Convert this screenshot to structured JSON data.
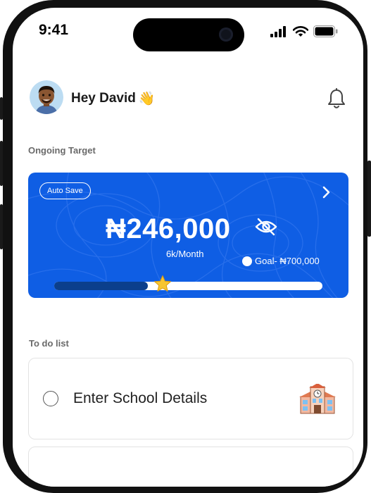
{
  "status_bar": {
    "time": "9:41"
  },
  "header": {
    "greeting": "Hey David",
    "wave_emoji": "👋"
  },
  "ongoing": {
    "section_title": "Ongoing Target",
    "badge": "Auto Save",
    "amount": "₦246,000",
    "per_month": "6k/Month",
    "goal": "Goal- ₦700,000",
    "progress_fraction": 0.35
  },
  "todo": {
    "section_title": "To do list",
    "items": [
      {
        "label": "Enter School Details"
      }
    ]
  },
  "colors": {
    "card_blue": "#0f5ee4",
    "progress_fill": "#0b3f8c",
    "star": "#f7c531"
  },
  "icons": [
    "signal-icon",
    "wifi-icon",
    "battery-icon",
    "bell-icon",
    "chevron-right-icon",
    "eye-off-icon",
    "star-icon",
    "school-icon"
  ]
}
